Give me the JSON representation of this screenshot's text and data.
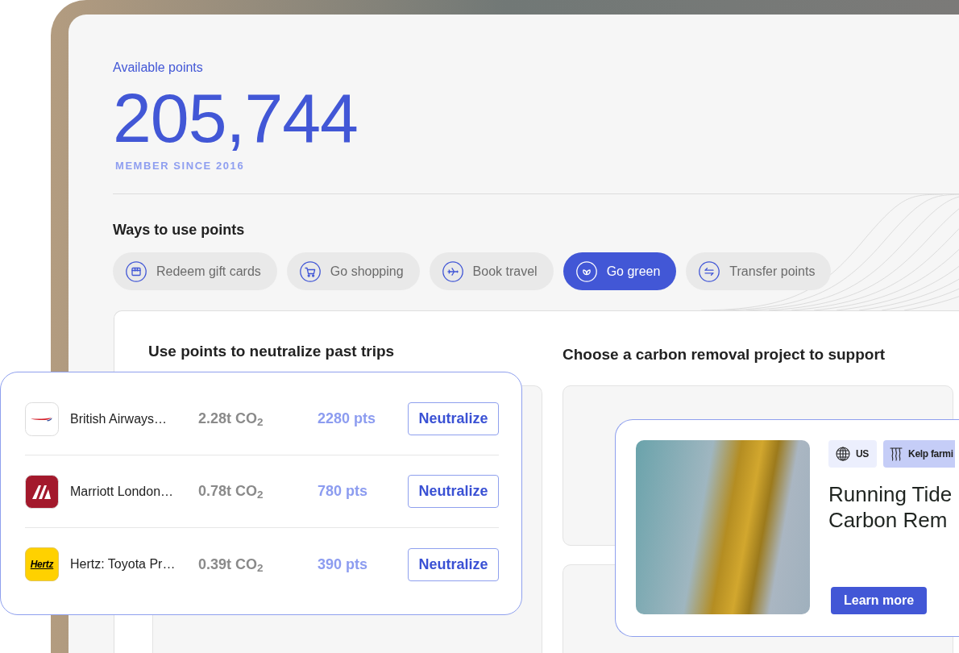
{
  "points": {
    "label": "Available points",
    "value": "205,744",
    "member_since": "MEMBER SINCE 2016"
  },
  "ways_to_use": {
    "title": "Ways to use points",
    "options": [
      {
        "kind": "giftcard",
        "label": "Redeem gift cards",
        "selected": false
      },
      {
        "kind": "shopping",
        "label": "Go shopping",
        "selected": false
      },
      {
        "kind": "travel",
        "label": "Book travel",
        "selected": false
      },
      {
        "kind": "green",
        "label": "Go green",
        "selected": true
      },
      {
        "kind": "transfer",
        "label": "Transfer points",
        "selected": false
      }
    ]
  },
  "past_trips": {
    "title": "Use points to neutralize past trips",
    "trips": [
      {
        "logo": {
          "kind": "swoosh"
        },
        "name": "British Airways…",
        "emissions": "2.28t CO$_{2}$",
        "cost": "2280 pts",
        "action": "Neutralize"
      },
      {
        "logo": {
          "kind": "monogram"
        },
        "name": "Marriott London…",
        "emissions": "0.78t CO$_{2}$",
        "cost": "780 pts",
        "action": "Neutralize"
      },
      {
        "logo": {
          "kind": "wordmark",
          "text": "Hertz"
        },
        "name": "Hertz: Toyota Pr…",
        "emissions": "0.39t CO$_{2}$",
        "cost": "390 pts",
        "action": "Neutralize"
      }
    ]
  },
  "projects": {
    "title": "Choose a carbon removal project to support",
    "featured": {
      "tags": [
        {
          "kind": "location",
          "label": "US"
        },
        {
          "kind": "method",
          "label": "Kelp farmi"
        }
      ],
      "title": "Running Tide Carbon Rem",
      "action": "Learn more"
    }
  }
}
